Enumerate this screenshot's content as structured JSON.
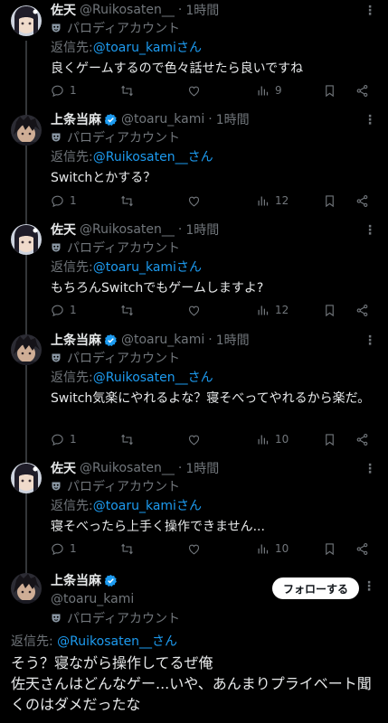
{
  "labels": {
    "reply_prefix": "返信先: ",
    "parody": "パロディアカウント",
    "follow_button": "フォローする",
    "more": "• • •"
  },
  "colors": {
    "background": "#000000",
    "accent": "#1d9bf0",
    "verified": "#1d9bf0",
    "muted": "#71767b"
  },
  "icons": [
    "reply-icon",
    "retweet-icon",
    "like-icon",
    "views-icon",
    "bookmark-icon",
    "share-icon",
    "verified-badge-icon",
    "parody-mask-icon",
    "more-icon"
  ],
  "tweets": [
    {
      "name": "佐天",
      "handle": "@Ruikosaten__",
      "dot": "·",
      "time": "1時間",
      "reply_to": "@toaru_kamiさん",
      "text": "良くゲームするので色々話せたら良いですね",
      "replies": "1",
      "retweets": "",
      "likes": "",
      "views": "9"
    },
    {
      "name": "上条当麻",
      "handle": "@toaru_kami",
      "dot": "·",
      "time": "1時間",
      "reply_to": "@Ruikosaten__さん",
      "text": "Switchとかする？",
      "replies": "1",
      "retweets": "",
      "likes": "",
      "views": "12"
    },
    {
      "name": "佐天",
      "handle": "@Ruikosaten__",
      "dot": "·",
      "time": "1時間",
      "reply_to": "@toaru_kamiさん",
      "text": "もちろんSwitchでもゲームしますよ?",
      "replies": "1",
      "retweets": "",
      "likes": "",
      "views": "12"
    },
    {
      "name": "上条当麻",
      "handle": "@toaru_kami",
      "dot": "·",
      "time": "1時間",
      "reply_to": "@Ruikosaten__さん",
      "text": "Switch気楽にやれるよな？寝そべってやれるから楽だ。",
      "replies": "1",
      "retweets": "",
      "likes": "",
      "views": "10"
    },
    {
      "name": "佐天",
      "handle": "@Ruikosaten__",
      "dot": "·",
      "time": "1時間",
      "reply_to": "@toaru_kamiさん",
      "text": "寝そべったら上手く操作できません...",
      "replies": "1",
      "retweets": "",
      "likes": "",
      "views": "10"
    }
  ],
  "main_tweet": {
    "name": "上条当麻",
    "handle": "@toaru_kami",
    "reply_to": "@Ruikosaten__さん",
    "text": "そう？寝ながら操作してるぜ俺\n佐天さんはどんなゲー...いや、あんまりプライベート聞くのはダメだったな"
  }
}
